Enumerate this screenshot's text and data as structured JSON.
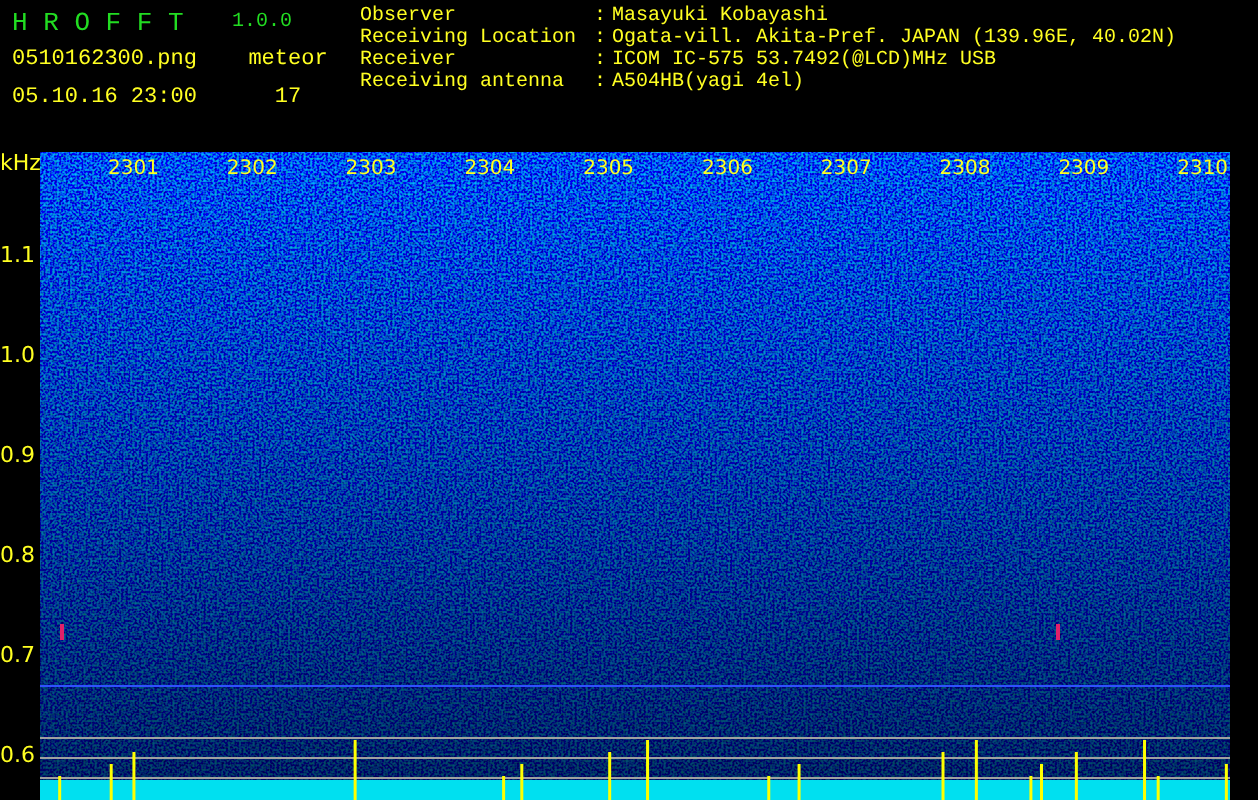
{
  "app": {
    "title": "H R O F F T",
    "version": "1.0.0"
  },
  "file": {
    "name": "0510162300.png",
    "datetime": "05.10.16 23:00"
  },
  "meteor": {
    "label": "meteor",
    "count": "17"
  },
  "info": [
    {
      "label": "Observer",
      "separator": ":",
      "value": "Masayuki Kobayashi"
    },
    {
      "label": "Receiving Location",
      "separator": ":",
      "value": "Ogata-vill. Akita-Pref. JAPAN (139.96E, 40.02N)"
    },
    {
      "label": "Receiver",
      "separator": ":",
      "value": "ICOM IC-575 53.7492(@LCD)MHz USB"
    },
    {
      "label": "Receiving antenna",
      "separator": ":",
      "value": "A504HB(yagi 4el)"
    }
  ],
  "spectrogram": {
    "unit": "kHz",
    "freq_labels": [
      "1.1",
      "1.0",
      "0.9",
      "0.8",
      "0.7",
      "0.6"
    ],
    "time_labels": [
      "2301",
      "2302",
      "2303",
      "2304",
      "2305",
      "2306",
      "2307",
      "2308",
      "2309",
      "2310"
    ]
  }
}
